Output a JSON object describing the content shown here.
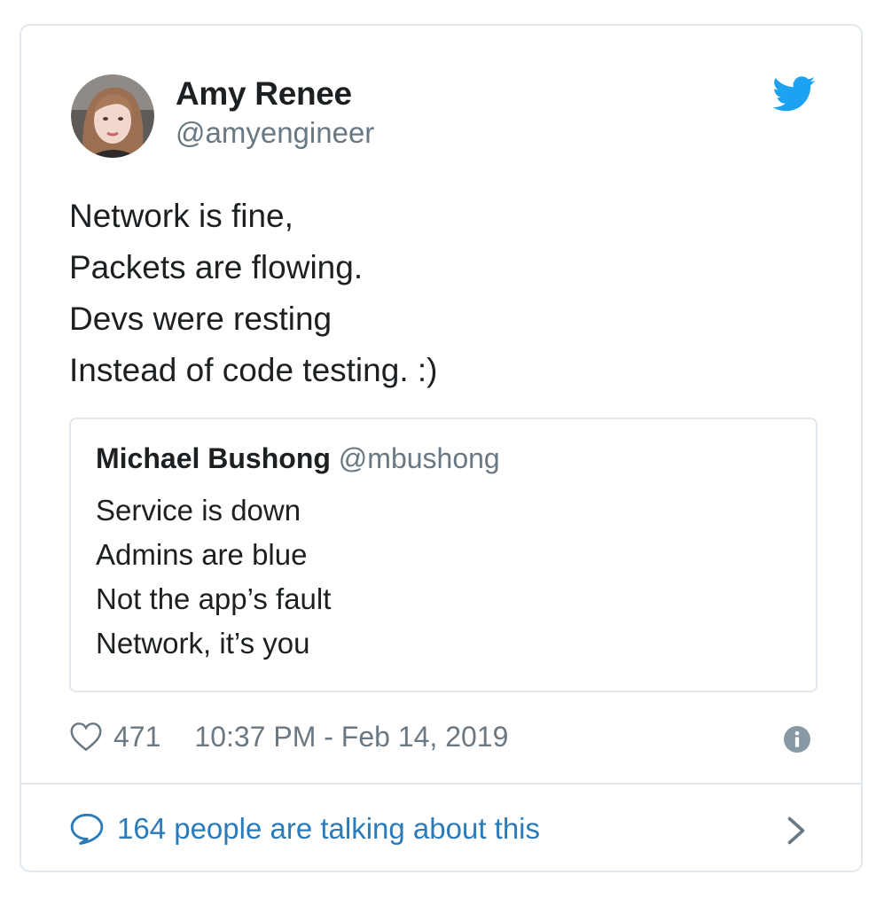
{
  "author": {
    "name": "Amy Renee",
    "handle": "@amyengineer"
  },
  "tweet": {
    "lines": [
      "Network is fine,",
      "Packets are flowing.",
      "Devs were resting",
      "Instead of code testing. :)"
    ]
  },
  "quoted_tweet": {
    "name": "Michael Bushong",
    "handle": "@mbushong",
    "lines": [
      "Service is down",
      "Admins are blue",
      "Not the app’s fault",
      "Network, it’s you"
    ]
  },
  "meta": {
    "likes": "471",
    "timestamp": "10:37 PM - Feb 14, 2019"
  },
  "footer": {
    "conversation_text": "164 people are talking about this"
  },
  "icons": {
    "brand": "twitter-bird-icon",
    "like": "heart-icon",
    "info": "info-icon",
    "conversation": "speech-bubble-icon",
    "navigate": "chevron-right-icon"
  },
  "colors": {
    "brand_blue": "#1da1f2",
    "link_blue": "#2b7bb9",
    "secondary_text": "#697882",
    "border": "#e1e8ed",
    "primary_text": "#1c2022"
  }
}
